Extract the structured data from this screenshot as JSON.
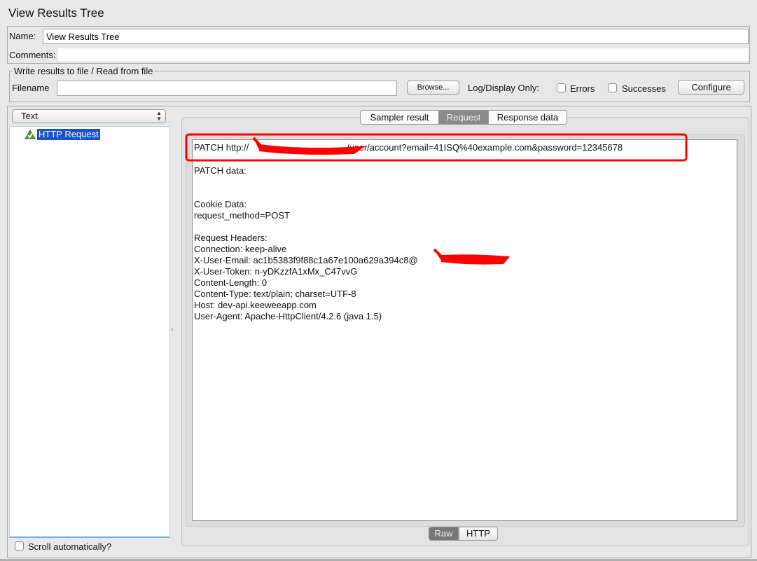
{
  "title": "View Results Tree",
  "name": {
    "label": "Name:",
    "value": "View Results Tree"
  },
  "comments": {
    "label": "Comments:",
    "value": ""
  },
  "file": {
    "legend": "Write results to file / Read from file",
    "filename_label": "Filename",
    "filename_value": "",
    "browse": "Browse...",
    "log_display_label": "Log/Display Only:",
    "errors": "Errors",
    "successes": "Successes",
    "configure": "Configure"
  },
  "renderer": {
    "selected": "Text"
  },
  "tree": {
    "items": [
      {
        "label": "HTTP Request"
      }
    ]
  },
  "scroll_auto": "Scroll automatically?",
  "tabs": [
    "Sampler result",
    "Request",
    "Response data"
  ],
  "request_lines": [
    "PATCH http://",
    "/user/account?email=41ISQ%40example.com&password=12345678",
    "PATCH data:",
    "",
    "",
    "Cookie Data:",
    "request_method=POST",
    "",
    "Request Headers:",
    "Connection: keep-alive",
    "X-User-Email: ac1b5383f9f88c1a67e100a629a394c8@",
    "X-User-Token: n-yDKzzfA1xMx_C47vvG",
    "Content-Length: 0",
    "Content-Type: text/plain; charset=UTF-8",
    "Host: dev-api.keeweeapp.com",
    "User-Agent: Apache-HttpClient/4.2.6 (java 1.5)"
  ],
  "view_buttons": [
    "Raw",
    "HTTP"
  ],
  "colors": {
    "annotation": "#ff0000",
    "selection": "#1a53c6"
  }
}
